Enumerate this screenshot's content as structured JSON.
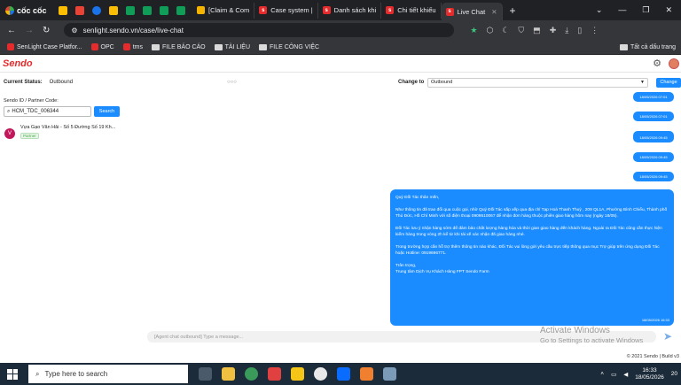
{
  "browser": {
    "brand": "cốc cốc",
    "tabs": [
      {
        "label": "[Claim & Com",
        "active": false
      },
      {
        "label": "Case system |",
        "active": false
      },
      {
        "label": "Danh sách khi",
        "active": false
      },
      {
        "label": "Chi tiết khiếu",
        "active": false
      },
      {
        "label": "Live Chat",
        "active": true
      }
    ],
    "url": "senlight.sendo.vn/case/live-chat",
    "bookmarks": [
      {
        "label": "SenLight Case Platfor...",
        "type": "site"
      },
      {
        "label": "OPC",
        "type": "site"
      },
      {
        "label": "tms",
        "type": "site"
      },
      {
        "label": "FILE BÁO CÁO",
        "type": "folder"
      },
      {
        "label": "TÀI LIỆU",
        "type": "folder"
      },
      {
        "label": "FILE CÔNG VIỆC",
        "type": "folder"
      }
    ],
    "all_bookmarks": "Tất cả dấu trang"
  },
  "app": {
    "logo": "Sendo",
    "status_label": "Current Status:",
    "status_value": "Outbound",
    "status_dots": "○○○",
    "change_to_label": "Change to",
    "change_to_value": "Outbound",
    "change_button": "Change",
    "search_label": "Sendo ID / Partner Code:",
    "search_value": "HCM_TDC_006344",
    "search_button": "Search",
    "partner": {
      "initial": "V",
      "name": "Vựa Gạo Văn Hải - Số 5 Đường Số 19 Kh...",
      "tag": "Partner"
    }
  },
  "chat": {
    "small_messages": [
      "18/05/2026 07:01",
      "18/05/2026 07:01",
      "18/05/2026 07:01",
      "18/05/2026 09:45",
      "18/05/2026 09:45",
      "18/05/2026 09:45"
    ],
    "big_message": {
      "paragraphs": [
        "Quý Đối Tác thân mến,",
        "Như thông tin đã trao đổi qua cuộc gọi, nhờ Quý Đối Tác sắp xếp qua địa chỉ Tạp Hoá Thanh Thuỷ , 209 QL1A, Phường Bình Chiểu, Thành phố Thủ Đức, Hồ Chí Minh với số điện thoại 0909510067 để nhận đơn hàng thuộc phiên giao hàng hôm nay (ngày 18/05).",
        "Đối Tác lưu ý nhận hàng sớm để đảm bảo chất lượng hàng hóa và thời gian giao hàng đến khách hàng. Ngoài ra Đối Tác cũng cần thực hiện kiểm hàng trong vòng 2h kể từ khi tài xế xác nhận đã giao hàng nhé.",
        "Trong trường hợp cần hỗ trợ thêm thông tin nào khác, Đối Tác vui lòng gửi yêu cầu trực tiếp thông qua mục Trợ giúp trên ứng dụng Đối Tác hoặc Hotline: 0919696771.",
        "Trân trọng,\nTrung tâm Dịch Vụ Khách Hàng FPT Sendo Farm"
      ],
      "time": "18/05/2026 16:33"
    },
    "input_placeholder": "[Agent chat outbound] Type a message..."
  },
  "watermark": {
    "line1": "Activate Windows",
    "line2": "Go to Settings to activate Windows"
  },
  "footer": "© 2021 Sendo | Build v3",
  "taskbar": {
    "search_placeholder": "Type here to search",
    "time": "16:33",
    "date": "18/05/2026",
    "badge": "20"
  }
}
